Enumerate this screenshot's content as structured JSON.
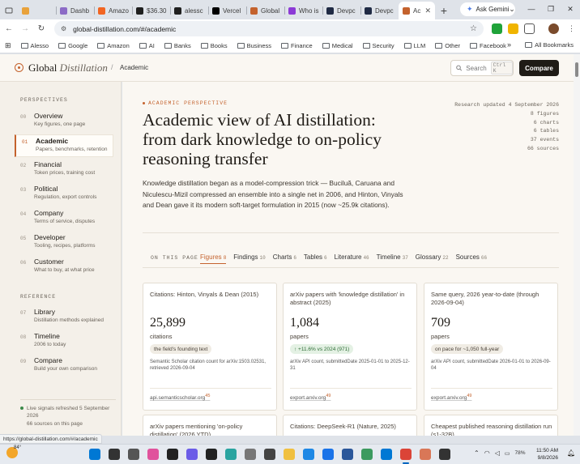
{
  "browser": {
    "tabs": [
      {
        "label": "",
        "color": "#e9a23b",
        "active": false
      },
      {
        "label": "Dashb",
        "color": "#8c6bc6",
        "active": false
      },
      {
        "label": "Amazo",
        "color": "#f26522",
        "active": false
      },
      {
        "label": "$36.30",
        "color": "#1f1f1f",
        "active": false
      },
      {
        "label": "alessc",
        "color": "#1f1f1f",
        "active": false
      },
      {
        "label": "Vercel",
        "color": "#000000",
        "active": false
      },
      {
        "label": "Global",
        "color": "#c4622d",
        "active": false
      },
      {
        "label": "Who is",
        "color": "#8c3ad6",
        "active": false
      },
      {
        "label": "Devpc",
        "color": "#1f2a44",
        "active": false
      },
      {
        "label": "Devpc",
        "color": "#1f2a44",
        "active": false
      },
      {
        "label": "Ac",
        "color": "#c4622d",
        "active": true
      }
    ],
    "ask_gemini": "Ask Gemini",
    "url": "global-distillation.com/#/academic",
    "bookmarks": [
      "Google",
      "Amazon",
      "AI",
      "Banks",
      "Books",
      "Business",
      "Finance",
      "Medical",
      "Security",
      "LLM",
      "Other",
      "Facebook"
    ],
    "first_bookmark": "Alesso",
    "all_bookmarks": "All Bookmarks",
    "status_url": "https://global-distillation.com/#/academic"
  },
  "site": {
    "logo_main": "Global",
    "logo_italic": "Distillation",
    "breadcrumb_sep": "/",
    "breadcrumb": "Academic",
    "search_label": "Search",
    "search_kbd": "Ctrl K",
    "compare_button": "Compare"
  },
  "sidebar": {
    "perspectives_heading": "PERSPECTIVES",
    "reference_heading": "REFERENCE",
    "perspectives": [
      {
        "num": "00",
        "label": "Overview",
        "sub": "Key figures, one page",
        "active": false
      },
      {
        "num": "01",
        "label": "Academic",
        "sub": "Papers, benchmarks, retention",
        "active": true
      },
      {
        "num": "02",
        "label": "Financial",
        "sub": "Token prices, training cost",
        "active": false
      },
      {
        "num": "03",
        "label": "Political",
        "sub": "Regulation, export controls",
        "active": false
      },
      {
        "num": "04",
        "label": "Company",
        "sub": "Terms of service, disputes",
        "active": false
      },
      {
        "num": "05",
        "label": "Developer",
        "sub": "Tooling, recipes, platforms",
        "active": false
      },
      {
        "num": "06",
        "label": "Customer",
        "sub": "What to buy, at what price",
        "active": false
      }
    ],
    "reference": [
      {
        "num": "07",
        "label": "Library",
        "sub": "Distillation methods explained"
      },
      {
        "num": "08",
        "label": "Timeline",
        "sub": "2006 to today"
      },
      {
        "num": "09",
        "label": "Compare",
        "sub": "Build your own comparison"
      }
    ],
    "live_line1": "Live signals refreshed 5 September 2026",
    "live_line2": "66 sources on this page"
  },
  "main": {
    "eyebrow": "ACADEMIC PERSPECTIVE",
    "title": "Academic view of AI distillation: from dark knowledge to on-policy reasoning transfer",
    "lead": "Knowledge distillation began as a model-compression trick — Buciluă, Caruana and Niculescu-Mizil compressed an ensemble into a single net in 2006, and Hinton, Vinyals and Dean gave it its modern soft-target formulation in 2015 (now ~25.9k citations).",
    "meta": [
      "Research updated 4 September 2026",
      "8 figures",
      "6 charts",
      "6 tables",
      "37 events",
      "66 sources"
    ],
    "on_this_page": "ON THIS PAGE",
    "subnav": [
      {
        "label": "Figures",
        "count": "8",
        "active": true
      },
      {
        "label": "Findings",
        "count": "10",
        "active": false
      },
      {
        "label": "Charts",
        "count": "6",
        "active": false
      },
      {
        "label": "Tables",
        "count": "6",
        "active": false
      },
      {
        "label": "Literature",
        "count": "46",
        "active": false
      },
      {
        "label": "Timeline",
        "count": "37",
        "active": false
      },
      {
        "label": "Glossary",
        "count": "22",
        "active": false
      },
      {
        "label": "Sources",
        "count": "66",
        "active": false
      }
    ],
    "cards": [
      {
        "title": "Citations: Hinton, Vinyals & Dean (2015)",
        "value": "25,899",
        "unit": "citations",
        "badge": "the field's founding text",
        "badge_type": "neutral",
        "note": "Semantic Scholar citation count for arXiv:1503.02531, retrieved 2026-09-04",
        "source": "api.semanticscholar.org",
        "ref": "45"
      },
      {
        "title": "arXiv papers with 'knowledge distillation' in abstract (2025)",
        "value": "1,084",
        "unit": "papers",
        "badge": "↑ +11.6% vs 2024 (971)",
        "badge_type": "green",
        "note": "arXiv API count, submittedDate 2025-01-01 to 2025-12-31",
        "source": "export.arxiv.org",
        "ref": "49"
      },
      {
        "title": "Same query, 2026 year-to-date (through 2026-09-04)",
        "value": "709",
        "unit": "papers",
        "badge": "on pace for ~1,050 full-year",
        "badge_type": "neutral",
        "note": "arXiv API count, submittedDate 2026-01-01 to 2026-09-04",
        "source": "export.arxiv.org",
        "ref": "49"
      },
      {
        "title": "arXiv papers mentioning 'on-policy distillation' (2026 YTD)",
        "value": "",
        "unit": "",
        "badge": "",
        "note": "",
        "source": "",
        "ref": ""
      },
      {
        "title": "Citations: DeepSeek-R1 (Nature, 2025)",
        "value": "",
        "unit": "",
        "badge": "",
        "note": "",
        "source": "",
        "ref": ""
      },
      {
        "title": "Cheapest published reasoning distillation run (s1-32B)",
        "value": "",
        "unit": "",
        "badge": "",
        "note": "",
        "source": "",
        "ref": ""
      }
    ]
  },
  "taskbar": {
    "temp": "84°",
    "battery": "78%",
    "time": "11:50 AM",
    "date": "9/8/2026"
  }
}
